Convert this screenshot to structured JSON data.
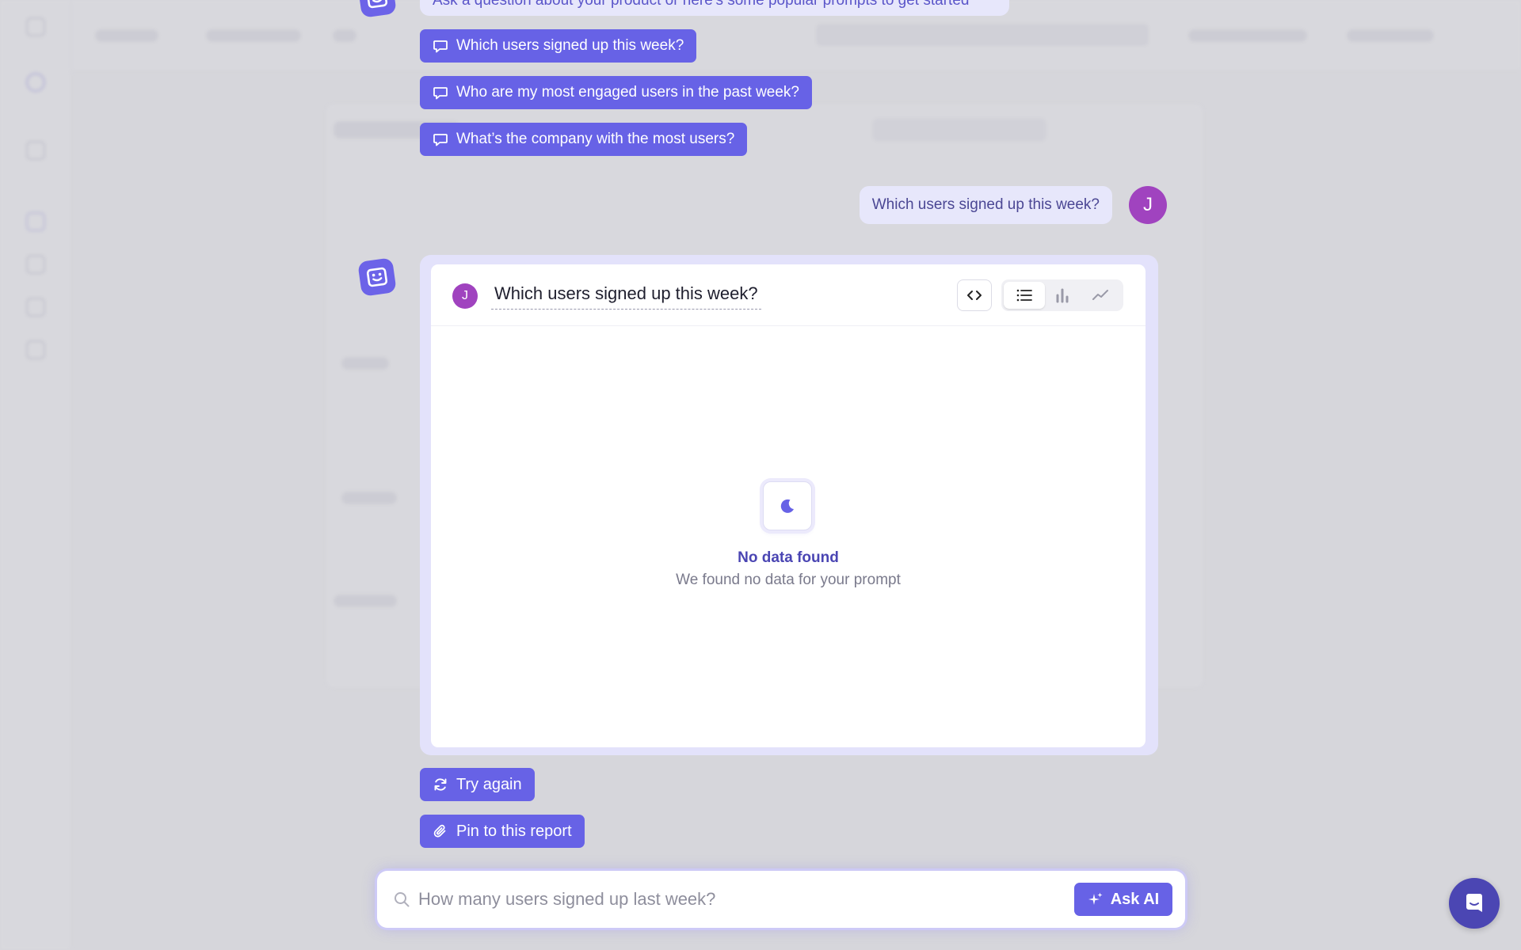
{
  "intro": {
    "message": "Ask a question about your product or here's some popular prompts to get started"
  },
  "prompts": [
    {
      "label": "Which users signed up this week?"
    },
    {
      "label": "Who are my most engaged users in the past week?"
    },
    {
      "label": "What’s the company with the most users?"
    }
  ],
  "user_message": {
    "text": "Which users signed up this week?",
    "avatar_initial": "J"
  },
  "result": {
    "avatar_initial": "J",
    "title": "Which users signed up this week?",
    "empty_title": "No data found",
    "empty_subtitle": "We found no data for your prompt",
    "view_options": [
      "list-icon",
      "bar-chart-icon",
      "line-chart-icon"
    ],
    "active_view": "list"
  },
  "actions": {
    "try_again": "Try again",
    "pin": "Pin to this report"
  },
  "ask": {
    "placeholder": "How many users signed up last week?",
    "button": "Ask AI"
  },
  "colors": {
    "accent": "#6762e6",
    "bubble": "#e7e7fb",
    "user_avatar": "#a043bf",
    "overlay": "#aaaab2"
  }
}
